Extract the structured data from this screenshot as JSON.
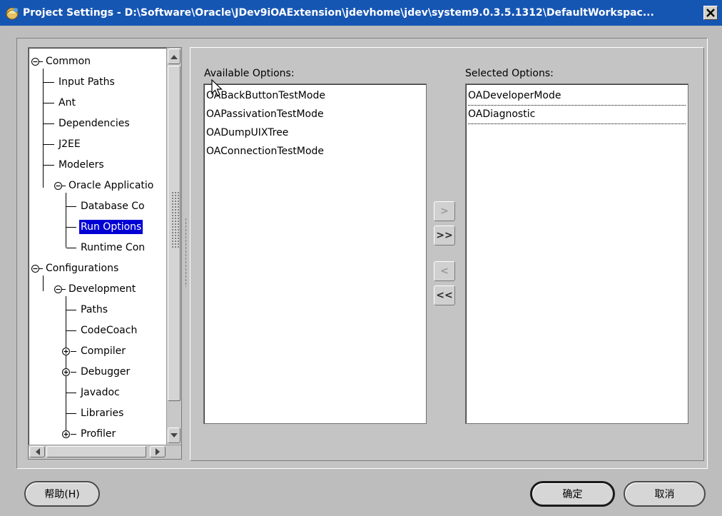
{
  "window": {
    "title": "Project Settings - D:\\Software\\Oracle\\JDev9iOAExtension\\jdevhome\\jdev\\system9.0.3.5.1312\\DefaultWorkspac..."
  },
  "tree": {
    "items": [
      {
        "label": "Common",
        "expanded": true,
        "selected": false
      },
      {
        "label": "Input Paths",
        "selected": false
      },
      {
        "label": "Ant",
        "selected": false
      },
      {
        "label": "Dependencies",
        "selected": false
      },
      {
        "label": "J2EE",
        "selected": false
      },
      {
        "label": "Modelers",
        "selected": false
      },
      {
        "label": "Oracle Applicatio",
        "expanded": true,
        "selected": false
      },
      {
        "label": "Database Co",
        "selected": false
      },
      {
        "label": "Run Options",
        "selected": true
      },
      {
        "label": "Runtime Con",
        "selected": false
      },
      {
        "label": "Configurations",
        "expanded": true,
        "selected": false
      },
      {
        "label": "Development",
        "expanded": true,
        "selected": false
      },
      {
        "label": "Paths",
        "selected": false
      },
      {
        "label": "CodeCoach",
        "selected": false
      },
      {
        "label": "Compiler",
        "expanded": false,
        "selected": false
      },
      {
        "label": "Debugger",
        "expanded": false,
        "selected": false
      },
      {
        "label": "Javadoc",
        "selected": false
      },
      {
        "label": "Libraries",
        "selected": false
      },
      {
        "label": "Profiler",
        "expanded": false,
        "selected": false
      }
    ]
  },
  "available": {
    "label": "Available Options:",
    "mnemonic": "v",
    "items": [
      "OABackButtonTestMode",
      "OAPassivationTestMode",
      "OADumpUIXTree",
      "OAConnectionTestMode"
    ]
  },
  "selected": {
    "label": "Selected Options:",
    "mnemonic": "S",
    "items": [
      "OADeveloperMode",
      "OADiagnostic"
    ]
  },
  "shuttle": {
    "move": ">",
    "move_all": ">>",
    "remove": "<",
    "remove_all": "<<"
  },
  "buttons": {
    "help": "帮助(H)",
    "ok": "确定",
    "cancel": "取消"
  },
  "colors": {
    "titlebar": "#1656b3",
    "selection": "#0000d4",
    "background": "#c4c4c4"
  }
}
